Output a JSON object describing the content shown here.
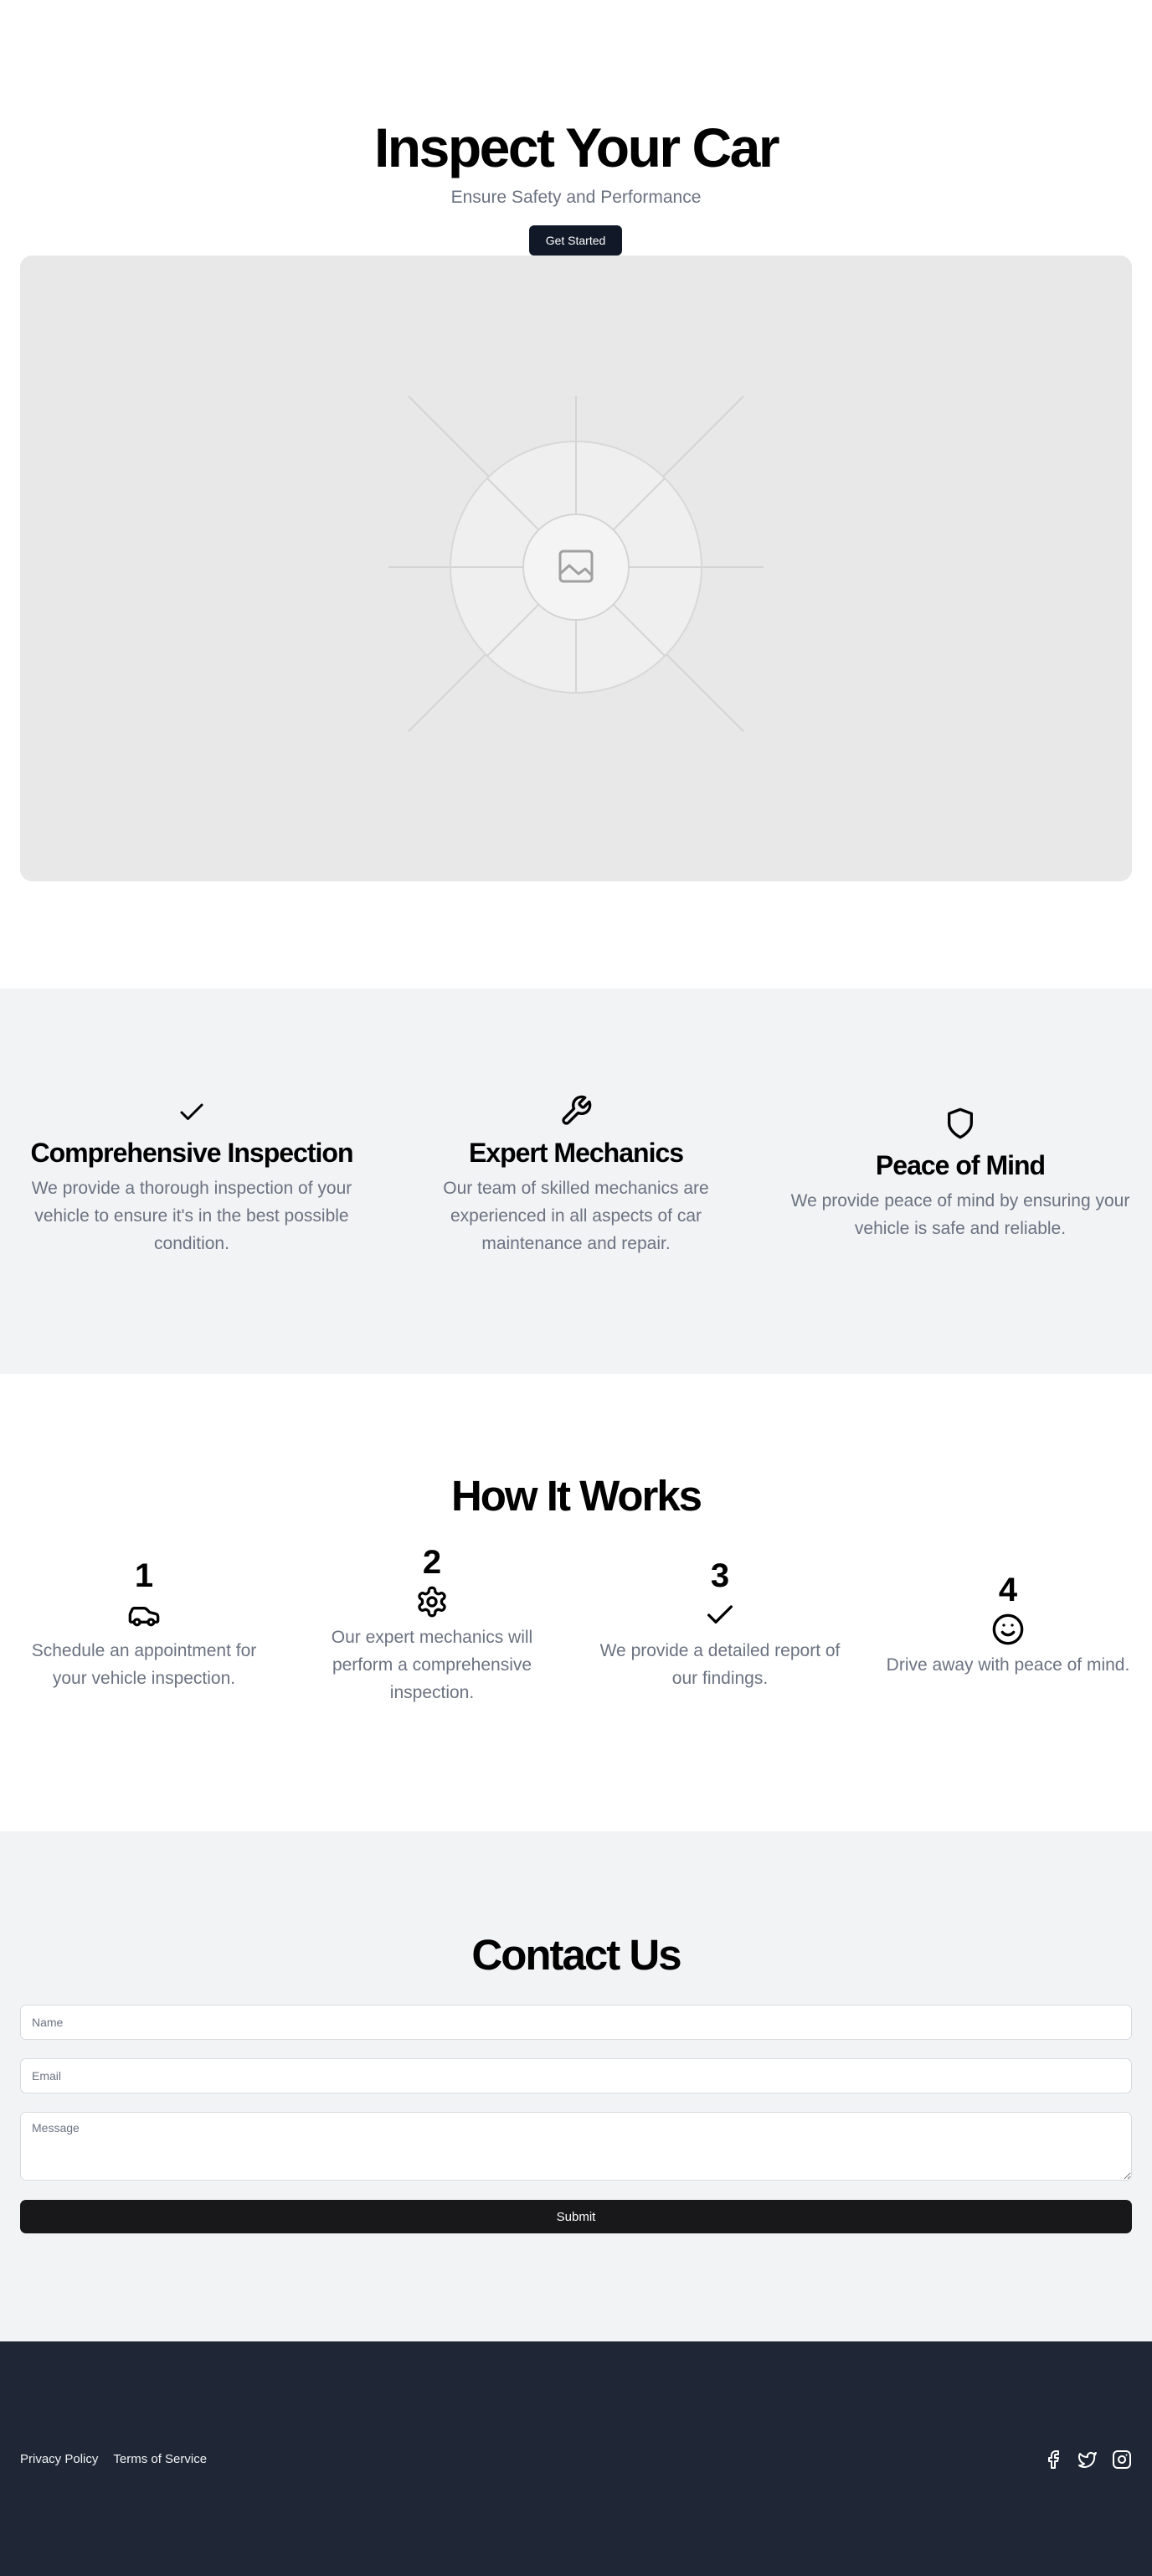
{
  "hero": {
    "title": "Inspect Your Car",
    "subtitle": "Ensure Safety and Performance",
    "cta_label": "Get Started",
    "image_icon": "image-placeholder-icon"
  },
  "features": [
    {
      "icon": "check-icon",
      "title": "Comprehensive Inspection",
      "description": "We provide a thorough inspection of your vehicle to ensure it's in the best possible condition."
    },
    {
      "icon": "wrench-icon",
      "title": "Expert Mechanics",
      "description": "Our team of skilled mechanics are experienced in all aspects of car maintenance and repair."
    },
    {
      "icon": "shield-icon",
      "title": "Peace of Mind",
      "description": "We provide peace of mind by ensuring your vehicle is safe and reliable."
    }
  ],
  "how_it_works": {
    "title": "How It Works",
    "steps": [
      {
        "number": "1",
        "icon": "car-icon",
        "text": "Schedule an appointment for your vehicle inspection."
      },
      {
        "number": "2",
        "icon": "gear-icon",
        "text": "Our expert mechanics will perform a comprehensive inspection."
      },
      {
        "number": "3",
        "icon": "check-icon",
        "text": "We provide a detailed report of our findings."
      },
      {
        "number": "4",
        "icon": "smile-icon",
        "text": "Drive away with peace of mind."
      }
    ]
  },
  "contact": {
    "title": "Contact Us",
    "name_placeholder": "Name",
    "email_placeholder": "Email",
    "message_placeholder": "Message",
    "submit_label": "Submit"
  },
  "footer": {
    "links": [
      "Privacy Policy",
      "Terms of Service"
    ],
    "social_icons": [
      "facebook-icon",
      "twitter-icon",
      "instagram-icon"
    ]
  },
  "colors": {
    "primary_dark": "#111827",
    "muted_text": "#6b7280",
    "section_bg": "#f2f3f5",
    "footer_bg": "#1f2635",
    "submit_bg": "#18181b"
  }
}
